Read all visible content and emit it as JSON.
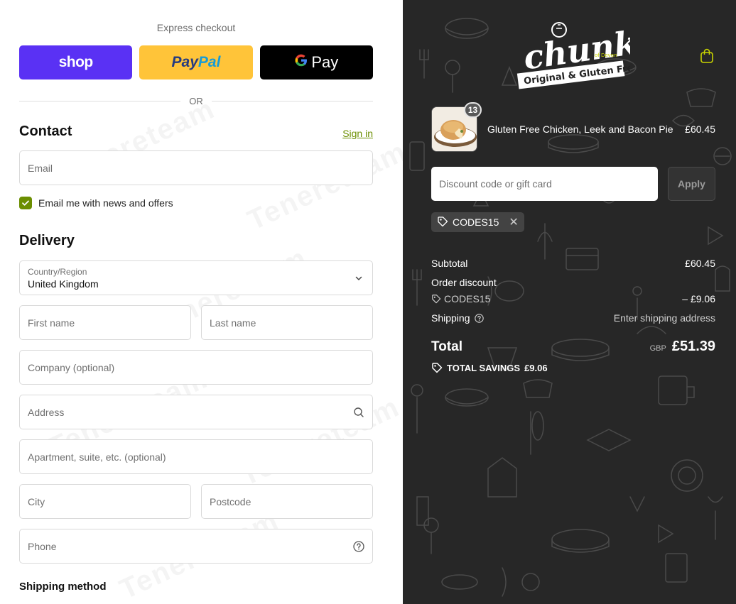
{
  "express": {
    "title": "Express checkout",
    "shop_label": "shop",
    "paypal_label_1": "Pay",
    "paypal_label_2": "Pal",
    "gpay_g": "G",
    "gpay_label": "Pay",
    "or": "OR"
  },
  "contact": {
    "title": "Contact",
    "signin": "Sign in",
    "email_placeholder": "Email",
    "newsletter_label": "Email me with news and offers",
    "newsletter_checked": true
  },
  "delivery": {
    "title": "Delivery",
    "country_label": "Country/Region",
    "country_value": "United Kingdom",
    "first_name_placeholder": "First name",
    "last_name_placeholder": "Last name",
    "company_placeholder": "Company (optional)",
    "address_placeholder": "Address",
    "apartment_placeholder": "Apartment, suite, etc. (optional)",
    "city_placeholder": "City",
    "postcode_placeholder": "Postcode",
    "phone_placeholder": "Phone"
  },
  "shipping_method": {
    "title": "Shipping method"
  },
  "watermark": "Tenereteam",
  "brand": {
    "name": "chunk",
    "sub": "of Devon",
    "tagline": "Original & Gluten Free"
  },
  "cart": {
    "item": {
      "name": "Gluten Free Chicken, Leek and Bacon Pie",
      "quantity": "13",
      "price": "£60.45"
    },
    "discount_placeholder": "Discount code or gift card",
    "apply_label": "Apply",
    "applied_code": "CODES15"
  },
  "summary": {
    "subtotal_label": "Subtotal",
    "subtotal_value": "£60.45",
    "order_discount_label": "Order discount",
    "discount_code": "CODES15",
    "discount_value": "– £9.06",
    "shipping_label": "Shipping",
    "shipping_value": "Enter shipping address",
    "total_label": "Total",
    "currency": "GBP",
    "total_value": "£51.39",
    "savings_label": "TOTAL SAVINGS",
    "savings_value": "£9.06"
  },
  "colors": {
    "accent": "#6b8e00",
    "shop": "#5a31f4",
    "paypal": "#ffc439",
    "gpay": "#000000",
    "summary_bg": "#272727"
  }
}
